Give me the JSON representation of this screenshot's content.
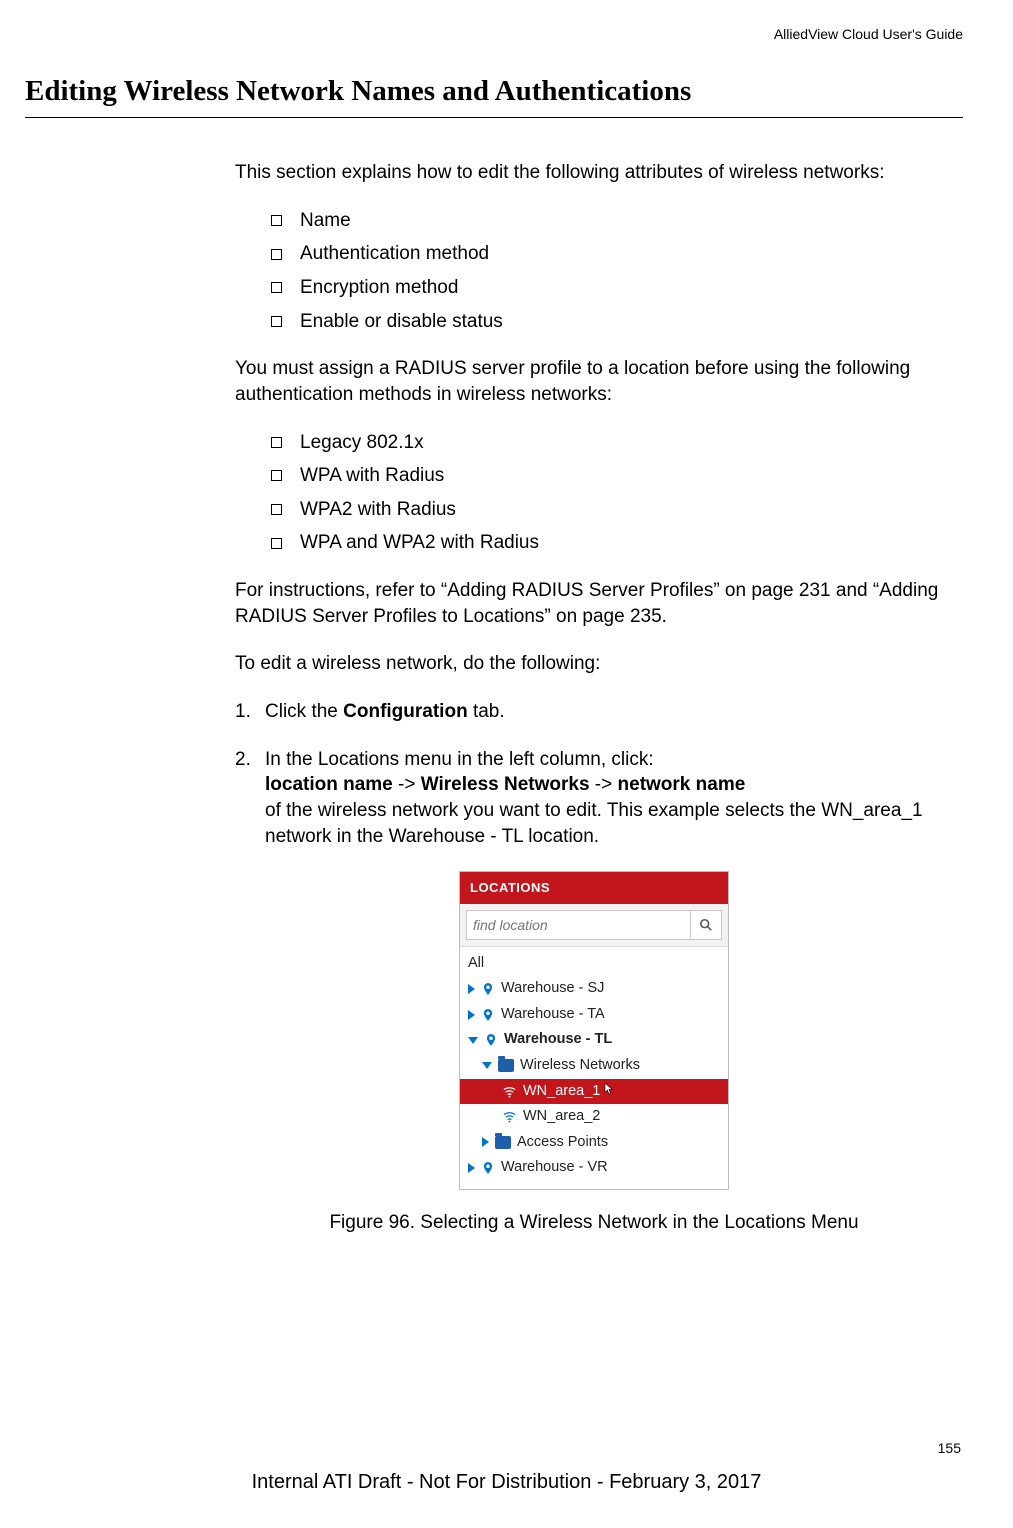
{
  "header": {
    "doc_title": "AlliedView Cloud User's Guide"
  },
  "title": "Editing Wireless Network Names and Authentications",
  "intro": "This section explains how to edit the following attributes of wireless networks:",
  "attr_bullets": [
    "Name",
    "Authentication method",
    "Encryption method",
    "Enable or disable status"
  ],
  "radius_intro": "You must assign a RADIUS server profile to a location before using the following authentication methods in wireless networks:",
  "radius_bullets": [
    "Legacy 802.1x",
    "WPA with Radius",
    "WPA2 with Radius",
    "WPA and WPA2 with Radius"
  ],
  "ref_text": "For instructions, refer to “Adding RADIUS Server Profiles” on page 231 and “Adding RADIUS Server Profiles to Locations” on page 235.",
  "edit_intro": "To edit a wireless network, do the following:",
  "step1": {
    "num": "1.",
    "pre": "Click the ",
    "bold": "Configuration",
    "post": " tab."
  },
  "step2": {
    "num": "2.",
    "line1": "In the Locations menu in the left column, click:",
    "path_a": "location name",
    "sep1": " -> ",
    "path_b": "Wireless Networks",
    "sep2": " -> ",
    "path_c": "network name",
    "line3": "of the wireless network you want to edit. This example selects the WN_area_1 network in the Warehouse - TL location."
  },
  "locations_panel": {
    "header": "LOCATIONS",
    "search_placeholder": "find location",
    "all": "All",
    "items": {
      "sj": "Warehouse - SJ",
      "ta": "Warehouse - TA",
      "tl": "Warehouse - TL",
      "wireless_networks": "Wireless Networks",
      "wn1": "WN_area_1",
      "wn2": "WN_area_2",
      "aps": "Access Points",
      "vr": "Warehouse - VR"
    }
  },
  "figure_caption": "Figure 96. Selecting a Wireless Network in the Locations Menu",
  "page_number": "155",
  "footer": "Internal ATI Draft - Not For Distribution - February 3, 2017"
}
